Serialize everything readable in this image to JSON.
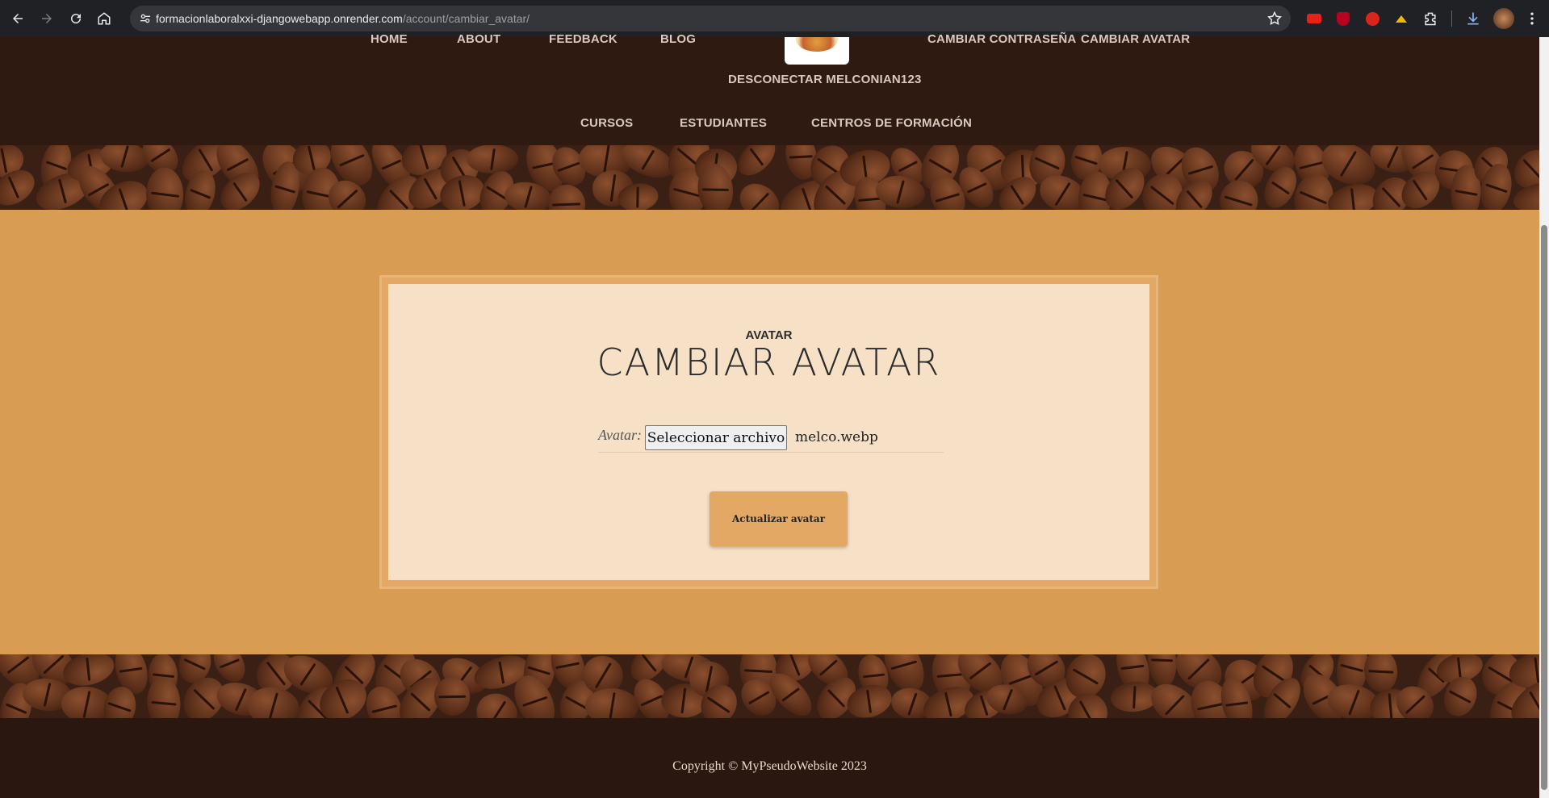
{
  "browser": {
    "url_host": "formacionlaboralxxi-djangowebapp.onrender.com",
    "url_path": "/account/cambiar_avatar/"
  },
  "nav": {
    "top_links": [
      "HOME",
      "ABOUT",
      "FEEDBACK",
      "BLOG",
      "CAMBIAR CONTRASEÑA",
      "CAMBIAR AVATAR"
    ],
    "logout": "DESCONECTAR MELCONIAN123",
    "secondary_links": [
      "CURSOS",
      "ESTUDIANTES",
      "CENTROS DE FORMACIÓN"
    ]
  },
  "card": {
    "kicker": "AVATAR",
    "title": "CAMBIAR AVATAR",
    "field_label": "Avatar:",
    "file_button": "Seleccionar archivo",
    "file_name": "melco.webp",
    "submit": "Actualizar avatar"
  },
  "footer": {
    "copyright": "Copyright © MyPseudoWebsite 2023"
  },
  "colors": {
    "header_bg": "#2f1a12",
    "section_bg": "#d89c52",
    "card_bg": "#f7e1c6",
    "button_bg": "#e3a864"
  }
}
